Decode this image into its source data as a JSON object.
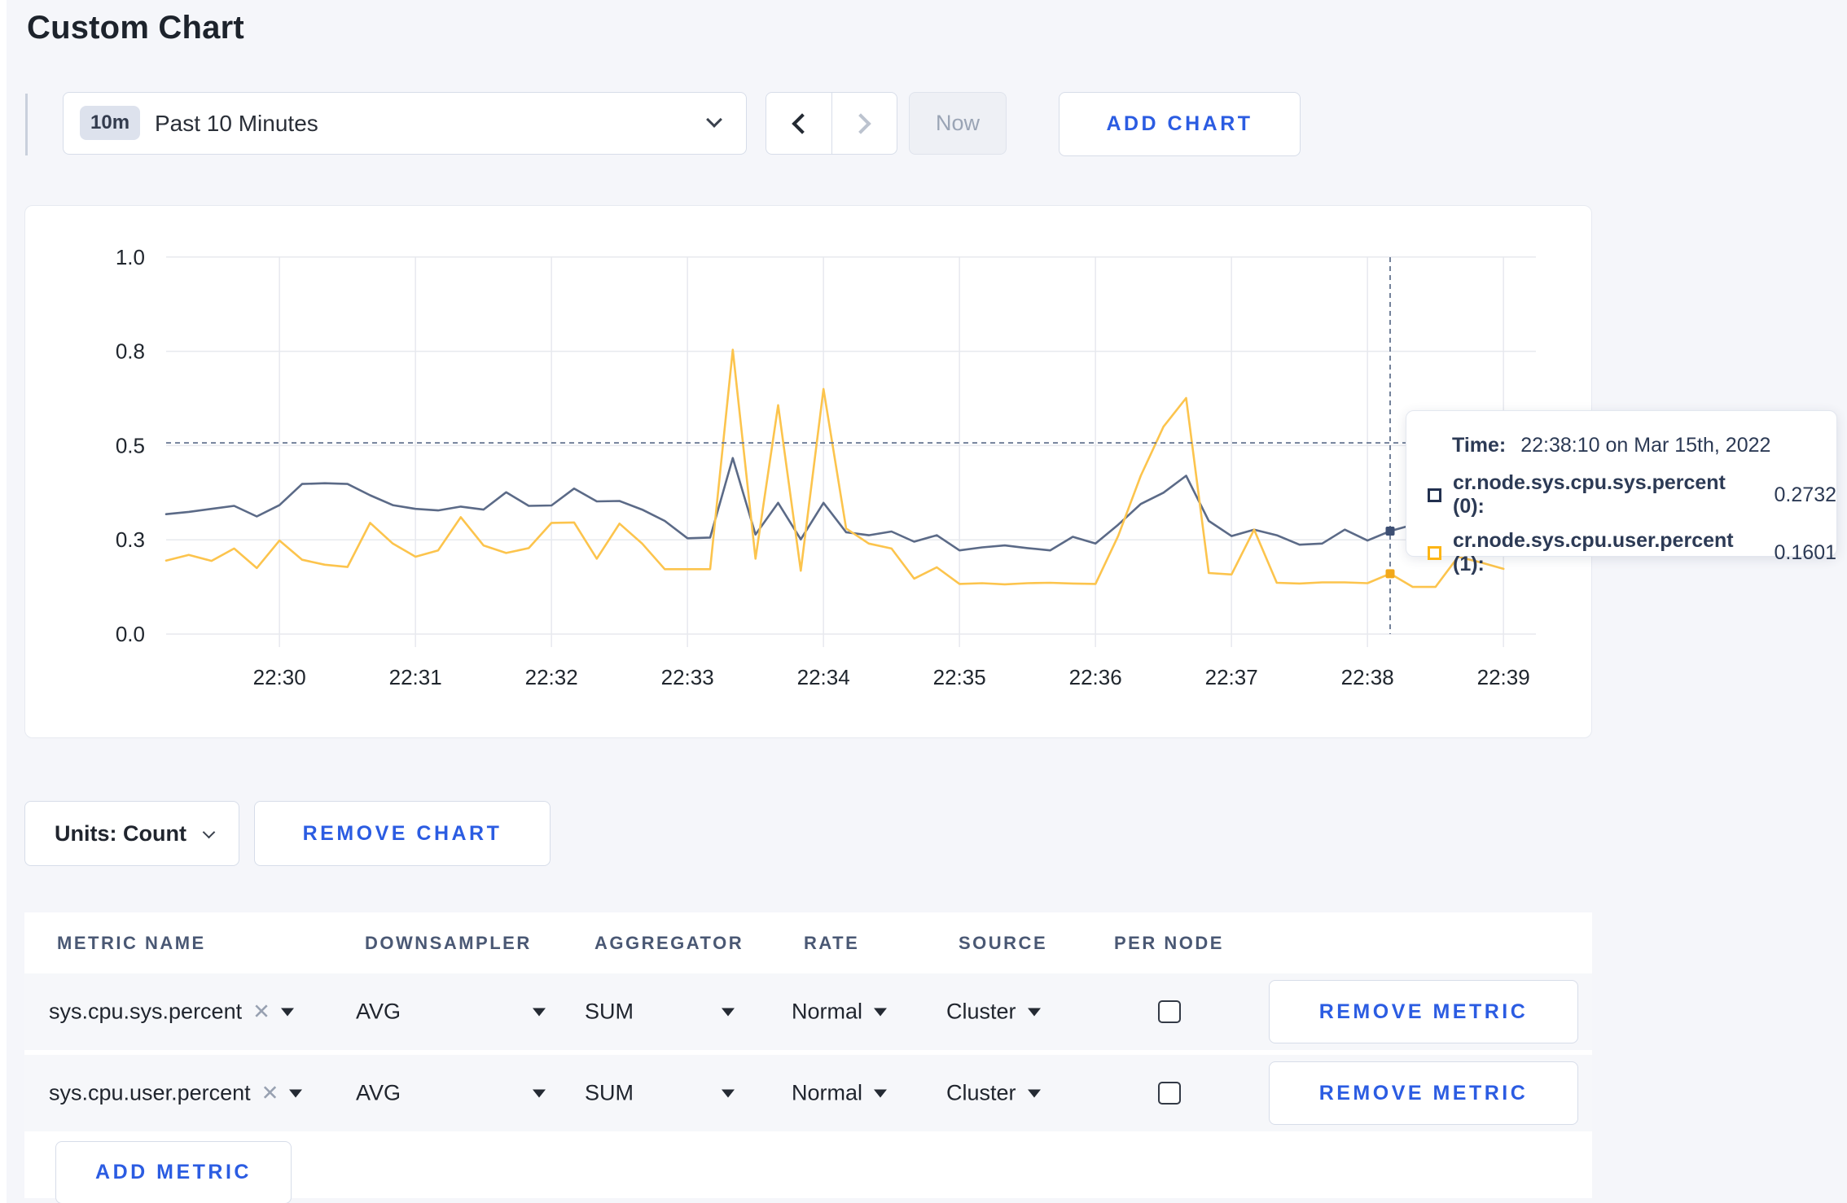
{
  "page": {
    "title": "Custom Chart",
    "background": "#f5f6fa",
    "accent_blue": "#2b5ce2"
  },
  "toolbar": {
    "time_range": {
      "badge": "10m",
      "label": "Past 10 Minutes"
    },
    "now_label": "Now",
    "add_chart_label": "ADD CHART"
  },
  "chart_data": {
    "type": "line",
    "title": "",
    "xlabel": "",
    "ylabel": "",
    "ylim": [
      0,
      1
    ],
    "grid": true,
    "x_start": "22:29:10",
    "interval_seconds": 10,
    "x_ticks": [
      "22:30",
      "22:31",
      "22:32",
      "22:33",
      "22:34",
      "22:35",
      "22:36",
      "22:37",
      "22:38",
      "22:39"
    ],
    "y_ticks": [
      {
        "v": 0,
        "label": "0.0"
      },
      {
        "v": 0.25,
        "label": "0.3"
      },
      {
        "v": 0.5,
        "label": "0.5"
      },
      {
        "v": 0.75,
        "label": "0.8"
      },
      {
        "v": 1.0,
        "label": "1.0"
      }
    ],
    "series": [
      {
        "name": "cr.node.sys.cpu.sys.percent (0)",
        "color": "#5b6a87",
        "dot_color": "#3d4f73",
        "values": [
          0.318,
          0.324,
          0.332,
          0.34,
          0.312,
          0.342,
          0.398,
          0.4,
          0.398,
          0.368,
          0.342,
          0.332,
          0.328,
          0.338,
          0.33,
          0.376,
          0.34,
          0.341,
          0.386,
          0.352,
          0.353,
          0.33,
          0.3,
          0.254,
          0.256,
          0.467,
          0.264,
          0.348,
          0.251,
          0.348,
          0.27,
          0.262,
          0.272,
          0.245,
          0.262,
          0.222,
          0.23,
          0.235,
          0.228,
          0.222,
          0.258,
          0.24,
          0.29,
          0.345,
          0.375,
          0.42,
          0.3,
          0.26,
          0.277,
          0.262,
          0.237,
          0.24,
          0.277,
          0.248,
          0.2732,
          0.29,
          0.3,
          0.295,
          0.3,
          0.302
        ]
      },
      {
        "name": "cr.node.sys.cpu.user.percent (1)",
        "color": "#fcc44d",
        "dot_color": "#f2a819",
        "values": [
          0.195,
          0.21,
          0.194,
          0.227,
          0.175,
          0.248,
          0.197,
          0.184,
          0.178,
          0.295,
          0.24,
          0.205,
          0.222,
          0.31,
          0.235,
          0.215,
          0.228,
          0.295,
          0.296,
          0.2,
          0.293,
          0.24,
          0.172,
          0.172,
          0.172,
          0.754,
          0.2,
          0.607,
          0.168,
          0.65,
          0.28,
          0.24,
          0.227,
          0.147,
          0.177,
          0.133,
          0.135,
          0.132,
          0.135,
          0.136,
          0.134,
          0.133,
          0.26,
          0.42,
          0.55,
          0.626,
          0.162,
          0.158,
          0.277,
          0.136,
          0.134,
          0.137,
          0.137,
          0.135,
          0.1601,
          0.125,
          0.125,
          0.205,
          0.19,
          0.173
        ]
      }
    ],
    "crosshair": {
      "time": "22:38:10",
      "hover_value": 0.507
    },
    "legend_position": "tooltip"
  },
  "tooltip": {
    "time_label": "Time:",
    "time_value": "22:38:10 on Mar 15th, 2022",
    "series": [
      {
        "name": "cr.node.sys.cpu.sys.percent (0):",
        "value": "0.2732",
        "color": "#22304f"
      },
      {
        "name": "cr.node.sys.cpu.user.percent (1):",
        "value": "0.1601",
        "color": "#fdb515"
      }
    ]
  },
  "chart_controls": {
    "units_label": "Units: Count",
    "remove_chart_label": "REMOVE CHART"
  },
  "metrics_table": {
    "headers": [
      "METRIC NAME",
      "DOWNSAMPLER",
      "AGGREGATOR",
      "RATE",
      "SOURCE",
      "PER NODE"
    ],
    "rows": [
      {
        "metric": "sys.cpu.sys.percent",
        "downsampler": "AVG",
        "aggregator": "SUM",
        "rate": "Normal",
        "source": "Cluster",
        "per_node_checked": false,
        "remove_label": "REMOVE METRIC"
      },
      {
        "metric": "sys.cpu.user.percent",
        "downsampler": "AVG",
        "aggregator": "SUM",
        "rate": "Normal",
        "source": "Cluster",
        "per_node_checked": false,
        "remove_label": "REMOVE METRIC"
      }
    ],
    "add_metric_label": "ADD METRIC"
  },
  "icons": {
    "close_x": "✕"
  }
}
